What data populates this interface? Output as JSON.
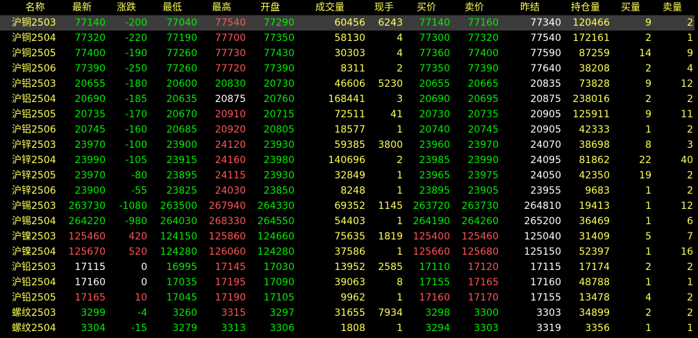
{
  "columns": [
    "名称",
    "最新",
    "涨跌",
    "最低",
    "最高",
    "开盘",
    "成交量",
    "现手",
    "买价",
    "卖价",
    "昨结",
    "持仓量",
    "买量",
    "卖量"
  ],
  "selected_row": 0,
  "colors": {
    "up": "#ff5555",
    "down": "#00ee00",
    "flat": "#ffffff",
    "volume": "#ffff57",
    "name": "#ffff57",
    "selected_bg": "#3c3c3c"
  },
  "rows": [
    {
      "name": "沪铜2503",
      "last": "77140",
      "change": "-200",
      "low": "77040",
      "high": "77540",
      "open": "77290",
      "volume": "60456",
      "cur": "6243",
      "bid": "77140",
      "ask": "77160",
      "prev": "77340",
      "oi": "120466",
      "bid_vol": "9",
      "ask_vol": "2",
      "c_last": "green",
      "c_change": "green",
      "c_low": "green",
      "c_high": "red",
      "c_open": "green",
      "c_bid": "green",
      "c_ask": "green"
    },
    {
      "name": "沪铜2504",
      "last": "77320",
      "change": "-220",
      "low": "77190",
      "high": "77700",
      "open": "77350",
      "volume": "58130",
      "cur": "4",
      "bid": "77300",
      "ask": "77320",
      "prev": "77540",
      "oi": "172161",
      "bid_vol": "2",
      "ask_vol": "1",
      "c_last": "green",
      "c_change": "green",
      "c_low": "green",
      "c_high": "red",
      "c_open": "green",
      "c_bid": "green",
      "c_ask": "green"
    },
    {
      "name": "沪铜2505",
      "last": "77400",
      "change": "-190",
      "low": "77260",
      "high": "77730",
      "open": "77430",
      "volume": "30303",
      "cur": "4",
      "bid": "77360",
      "ask": "77400",
      "prev": "77590",
      "oi": "87259",
      "bid_vol": "14",
      "ask_vol": "9",
      "c_last": "green",
      "c_change": "green",
      "c_low": "green",
      "c_high": "red",
      "c_open": "green",
      "c_bid": "green",
      "c_ask": "green"
    },
    {
      "name": "沪铜2506",
      "last": "77390",
      "change": "-250",
      "low": "77260",
      "high": "77720",
      "open": "77390",
      "volume": "8311",
      "cur": "2",
      "bid": "77350",
      "ask": "77390",
      "prev": "77640",
      "oi": "38208",
      "bid_vol": "2",
      "ask_vol": "4",
      "c_last": "green",
      "c_change": "green",
      "c_low": "green",
      "c_high": "red",
      "c_open": "green",
      "c_bid": "green",
      "c_ask": "green"
    },
    {
      "name": "沪铝2503",
      "last": "20655",
      "change": "-180",
      "low": "20600",
      "high": "20830",
      "open": "20730",
      "volume": "46606",
      "cur": "5230",
      "bid": "20655",
      "ask": "20665",
      "prev": "20835",
      "oi": "73828",
      "bid_vol": "9",
      "ask_vol": "12",
      "c_last": "green",
      "c_change": "green",
      "c_low": "green",
      "c_high": "green",
      "c_open": "green",
      "c_bid": "green",
      "c_ask": "green"
    },
    {
      "name": "沪铝2504",
      "last": "20690",
      "change": "-185",
      "low": "20635",
      "high": "20875",
      "open": "20760",
      "volume": "168441",
      "cur": "3",
      "bid": "20690",
      "ask": "20695",
      "prev": "20875",
      "oi": "238016",
      "bid_vol": "2",
      "ask_vol": "2",
      "c_last": "green",
      "c_change": "green",
      "c_low": "green",
      "c_high": "white",
      "c_open": "green",
      "c_bid": "green",
      "c_ask": "green"
    },
    {
      "name": "沪铝2505",
      "last": "20735",
      "change": "-170",
      "low": "20670",
      "high": "20910",
      "open": "20715",
      "volume": "72511",
      "cur": "41",
      "bid": "20730",
      "ask": "20735",
      "prev": "20905",
      "oi": "125911",
      "bid_vol": "9",
      "ask_vol": "11",
      "c_last": "green",
      "c_change": "green",
      "c_low": "green",
      "c_high": "red",
      "c_open": "green",
      "c_bid": "green",
      "c_ask": "green"
    },
    {
      "name": "沪铝2506",
      "last": "20745",
      "change": "-160",
      "low": "20685",
      "high": "20920",
      "open": "20805",
      "volume": "18577",
      "cur": "1",
      "bid": "20740",
      "ask": "20745",
      "prev": "20905",
      "oi": "42333",
      "bid_vol": "1",
      "ask_vol": "2",
      "c_last": "green",
      "c_change": "green",
      "c_low": "green",
      "c_high": "red",
      "c_open": "green",
      "c_bid": "green",
      "c_ask": "green"
    },
    {
      "name": "沪锌2503",
      "last": "23970",
      "change": "-100",
      "low": "23900",
      "high": "24120",
      "open": "23930",
      "volume": "59385",
      "cur": "3800",
      "bid": "23960",
      "ask": "23970",
      "prev": "24070",
      "oi": "38698",
      "bid_vol": "8",
      "ask_vol": "3",
      "c_last": "green",
      "c_change": "green",
      "c_low": "green",
      "c_high": "red",
      "c_open": "green",
      "c_bid": "green",
      "c_ask": "green"
    },
    {
      "name": "沪锌2504",
      "last": "23990",
      "change": "-105",
      "low": "23915",
      "high": "24160",
      "open": "23980",
      "volume": "140696",
      "cur": "2",
      "bid": "23985",
      "ask": "23990",
      "prev": "24095",
      "oi": "81862",
      "bid_vol": "22",
      "ask_vol": "40",
      "c_last": "green",
      "c_change": "green",
      "c_low": "green",
      "c_high": "red",
      "c_open": "green",
      "c_bid": "green",
      "c_ask": "green"
    },
    {
      "name": "沪锌2505",
      "last": "23970",
      "change": "-80",
      "low": "23895",
      "high": "24115",
      "open": "23930",
      "volume": "32849",
      "cur": "1",
      "bid": "23965",
      "ask": "23975",
      "prev": "24050",
      "oi": "42350",
      "bid_vol": "19",
      "ask_vol": "2",
      "c_last": "green",
      "c_change": "green",
      "c_low": "green",
      "c_high": "red",
      "c_open": "green",
      "c_bid": "green",
      "c_ask": "green"
    },
    {
      "name": "沪锌2506",
      "last": "23900",
      "change": "-55",
      "low": "23825",
      "high": "24030",
      "open": "23850",
      "volume": "8248",
      "cur": "1",
      "bid": "23895",
      "ask": "23905",
      "prev": "23955",
      "oi": "9683",
      "bid_vol": "1",
      "ask_vol": "2",
      "c_last": "green",
      "c_change": "green",
      "c_low": "green",
      "c_high": "red",
      "c_open": "green",
      "c_bid": "green",
      "c_ask": "green"
    },
    {
      "name": "沪锡2503",
      "last": "263730",
      "change": "-1080",
      "low": "263500",
      "high": "267940",
      "open": "264330",
      "volume": "69352",
      "cur": "1145",
      "bid": "263720",
      "ask": "263730",
      "prev": "264810",
      "oi": "19413",
      "bid_vol": "1",
      "ask_vol": "12",
      "c_last": "green",
      "c_change": "green",
      "c_low": "green",
      "c_high": "red",
      "c_open": "green",
      "c_bid": "green",
      "c_ask": "green"
    },
    {
      "name": "沪锡2504",
      "last": "264220",
      "change": "-980",
      "low": "264030",
      "high": "268330",
      "open": "264550",
      "volume": "54403",
      "cur": "1",
      "bid": "264190",
      "ask": "264260",
      "prev": "265200",
      "oi": "36469",
      "bid_vol": "1",
      "ask_vol": "6",
      "c_last": "green",
      "c_change": "green",
      "c_low": "green",
      "c_high": "red",
      "c_open": "green",
      "c_bid": "green",
      "c_ask": "green"
    },
    {
      "name": "沪镍2503",
      "last": "125460",
      "change": "420",
      "low": "124150",
      "high": "125860",
      "open": "124660",
      "volume": "75635",
      "cur": "1819",
      "bid": "125400",
      "ask": "125460",
      "prev": "125040",
      "oi": "31409",
      "bid_vol": "5",
      "ask_vol": "7",
      "c_last": "red",
      "c_change": "red",
      "c_low": "green",
      "c_high": "red",
      "c_open": "green",
      "c_bid": "red",
      "c_ask": "red"
    },
    {
      "name": "沪镍2504",
      "last": "125670",
      "change": "520",
      "low": "124280",
      "high": "126060",
      "open": "124280",
      "volume": "37586",
      "cur": "1",
      "bid": "125660",
      "ask": "125680",
      "prev": "125150",
      "oi": "52397",
      "bid_vol": "1",
      "ask_vol": "16",
      "c_last": "red",
      "c_change": "red",
      "c_low": "green",
      "c_high": "red",
      "c_open": "green",
      "c_bid": "red",
      "c_ask": "red"
    },
    {
      "name": "沪铅2503",
      "last": "17115",
      "change": "0",
      "low": "16995",
      "high": "17145",
      "open": "17030",
      "volume": "13952",
      "cur": "2585",
      "bid": "17110",
      "ask": "17120",
      "prev": "17115",
      "oi": "17174",
      "bid_vol": "2",
      "ask_vol": "2",
      "c_last": "white",
      "c_change": "white",
      "c_low": "green",
      "c_high": "red",
      "c_open": "green",
      "c_bid": "green",
      "c_ask": "red"
    },
    {
      "name": "沪铅2504",
      "last": "17160",
      "change": "0",
      "low": "17035",
      "high": "17195",
      "open": "17090",
      "volume": "39063",
      "cur": "8",
      "bid": "17155",
      "ask": "17165",
      "prev": "17160",
      "oi": "48788",
      "bid_vol": "1",
      "ask_vol": "1",
      "c_last": "white",
      "c_change": "white",
      "c_low": "green",
      "c_high": "red",
      "c_open": "green",
      "c_bid": "green",
      "c_ask": "red"
    },
    {
      "name": "沪铅2505",
      "last": "17165",
      "change": "10",
      "low": "17045",
      "high": "17190",
      "open": "17105",
      "volume": "9962",
      "cur": "1",
      "bid": "17160",
      "ask": "17170",
      "prev": "17155",
      "oi": "13478",
      "bid_vol": "4",
      "ask_vol": "2",
      "c_last": "red",
      "c_change": "red",
      "c_low": "green",
      "c_high": "red",
      "c_open": "green",
      "c_bid": "red",
      "c_ask": "red"
    },
    {
      "name": "螺纹2503",
      "last": "3299",
      "change": "-4",
      "low": "3260",
      "high": "3315",
      "open": "3297",
      "volume": "31655",
      "cur": "7934",
      "bid": "3298",
      "ask": "3300",
      "prev": "3303",
      "oi": "34899",
      "bid_vol": "2",
      "ask_vol": "2",
      "c_last": "green",
      "c_change": "green",
      "c_low": "green",
      "c_high": "red",
      "c_open": "green",
      "c_bid": "green",
      "c_ask": "green"
    },
    {
      "name": "螺纹2504",
      "last": "3304",
      "change": "-15",
      "low": "3279",
      "high": "3313",
      "open": "3306",
      "volume": "1808",
      "cur": "1",
      "bid": "3294",
      "ask": "3303",
      "prev": "3319",
      "oi": "3356",
      "bid_vol": "1",
      "ask_vol": "1",
      "c_last": "green",
      "c_change": "green",
      "c_low": "green",
      "c_high": "green",
      "c_open": "green",
      "c_bid": "green",
      "c_ask": "green"
    }
  ]
}
